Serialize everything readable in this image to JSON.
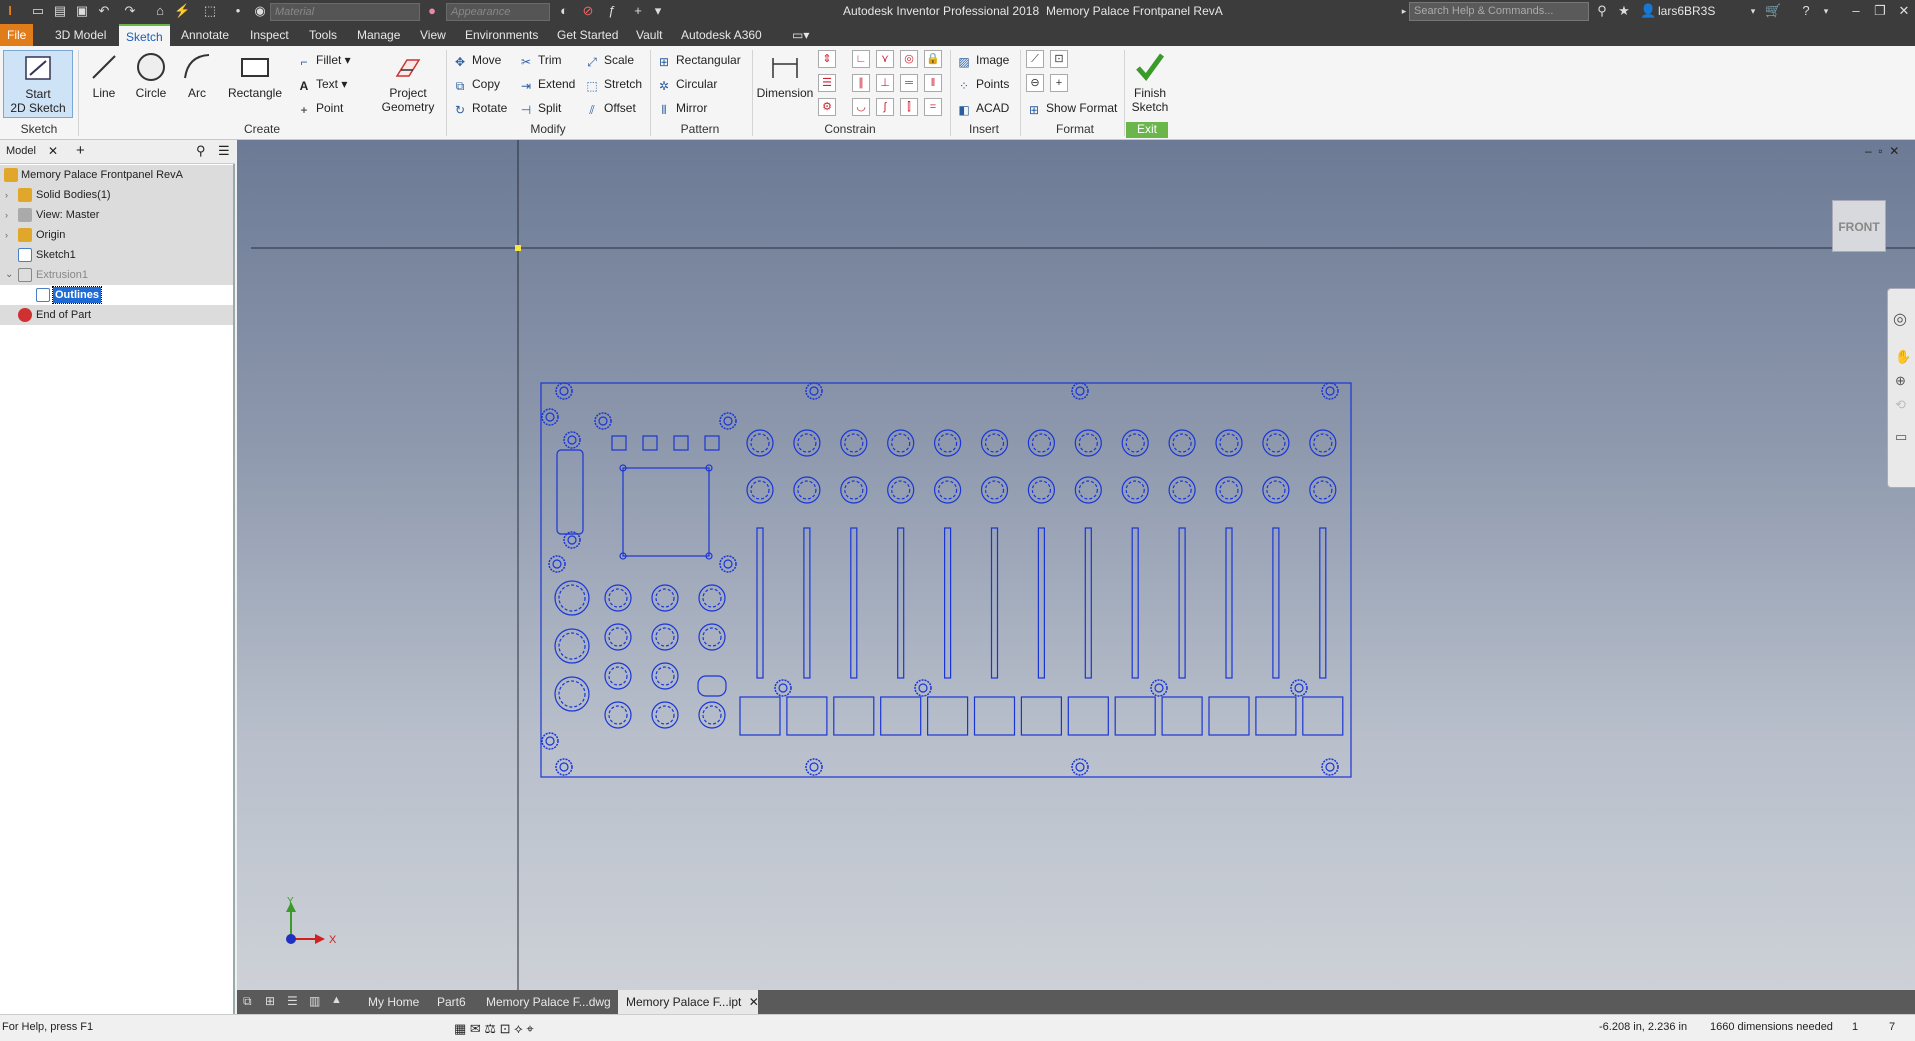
{
  "title_bar": {
    "app_title": "Autodesk Inventor Professional 2018",
    "doc_title": "Memory Palace Frontpanel RevA",
    "material_placeholder": "Material",
    "appearance_placeholder": "Appearance",
    "search_placeholder": "Search Help & Commands...",
    "user": "lars6BR3S"
  },
  "menu_tabs": [
    "File",
    "3D Model",
    "Sketch",
    "Annotate",
    "Inspect",
    "Tools",
    "Manage",
    "View",
    "Environments",
    "Get Started",
    "Vault",
    "Autodesk A360"
  ],
  "active_tab": "Sketch",
  "ribbon": {
    "sketch_panel": {
      "title": "Sketch",
      "start_sketch": "Start",
      "start_sketch_2": "2D Sketch"
    },
    "create_panel": {
      "title": "Create",
      "line": "Line",
      "circle": "Circle",
      "arc": "Arc",
      "rectangle": "Rectangle",
      "fillet": "Fillet",
      "text": "Text",
      "point": "Point",
      "project_geometry_1": "Project",
      "project_geometry_2": "Geometry"
    },
    "modify_panel": {
      "title": "Modify",
      "move": "Move",
      "copy": "Copy",
      "rotate": "Rotate",
      "trim": "Trim",
      "extend": "Extend",
      "split": "Split",
      "scale": "Scale",
      "stretch": "Stretch",
      "offset": "Offset"
    },
    "pattern_panel": {
      "title": "Pattern",
      "rectangular": "Rectangular",
      "circular": "Circular",
      "mirror": "Mirror"
    },
    "constrain_panel": {
      "title": "Constrain",
      "dimension": "Dimension"
    },
    "insert_panel": {
      "title": "Insert",
      "image": "Image",
      "points": "Points",
      "acad": "ACAD"
    },
    "format_panel": {
      "title": "Format",
      "show_format": "Show Format"
    },
    "exit_panel": {
      "title": "Exit",
      "finish_1": "Finish",
      "finish_2": "Sketch"
    }
  },
  "browser": {
    "tab": "Model",
    "items": [
      {
        "label": "Memory Palace Frontpanel RevA",
        "color": "#e0a72a"
      },
      {
        "label": "Solid Bodies(1)",
        "color": "#e0a72a"
      },
      {
        "label": "View: Master",
        "color": "#777777"
      },
      {
        "label": "Origin",
        "color": "#e0a72a"
      },
      {
        "label": "Sketch1",
        "color": "#4a7fc1"
      },
      {
        "label": "Extrusion1",
        "color": "#888888"
      },
      {
        "label": "Outlines",
        "color": "#4a7fc1"
      },
      {
        "label": "End of Part",
        "color": "#d03030"
      }
    ]
  },
  "viewport": {
    "viewcube_label": "FRONT",
    "axis_x": "X",
    "axis_y": "Y"
  },
  "doc_tabs": [
    "My Home",
    "Part6",
    "Memory Palace F...dwg",
    "Memory Palace F...ipt"
  ],
  "active_doc_tab": "Memory Palace F...ipt",
  "status": {
    "help": "For Help, press F1",
    "coords": "-6.208 in, 2.236 in",
    "dimensions": "1660 dimensions needed",
    "count_a": "1",
    "count_b": "7"
  },
  "colors": {
    "accent": "#6bb64a",
    "file_tab": "#e07c1a",
    "sketch_line": "#1a35d6"
  }
}
